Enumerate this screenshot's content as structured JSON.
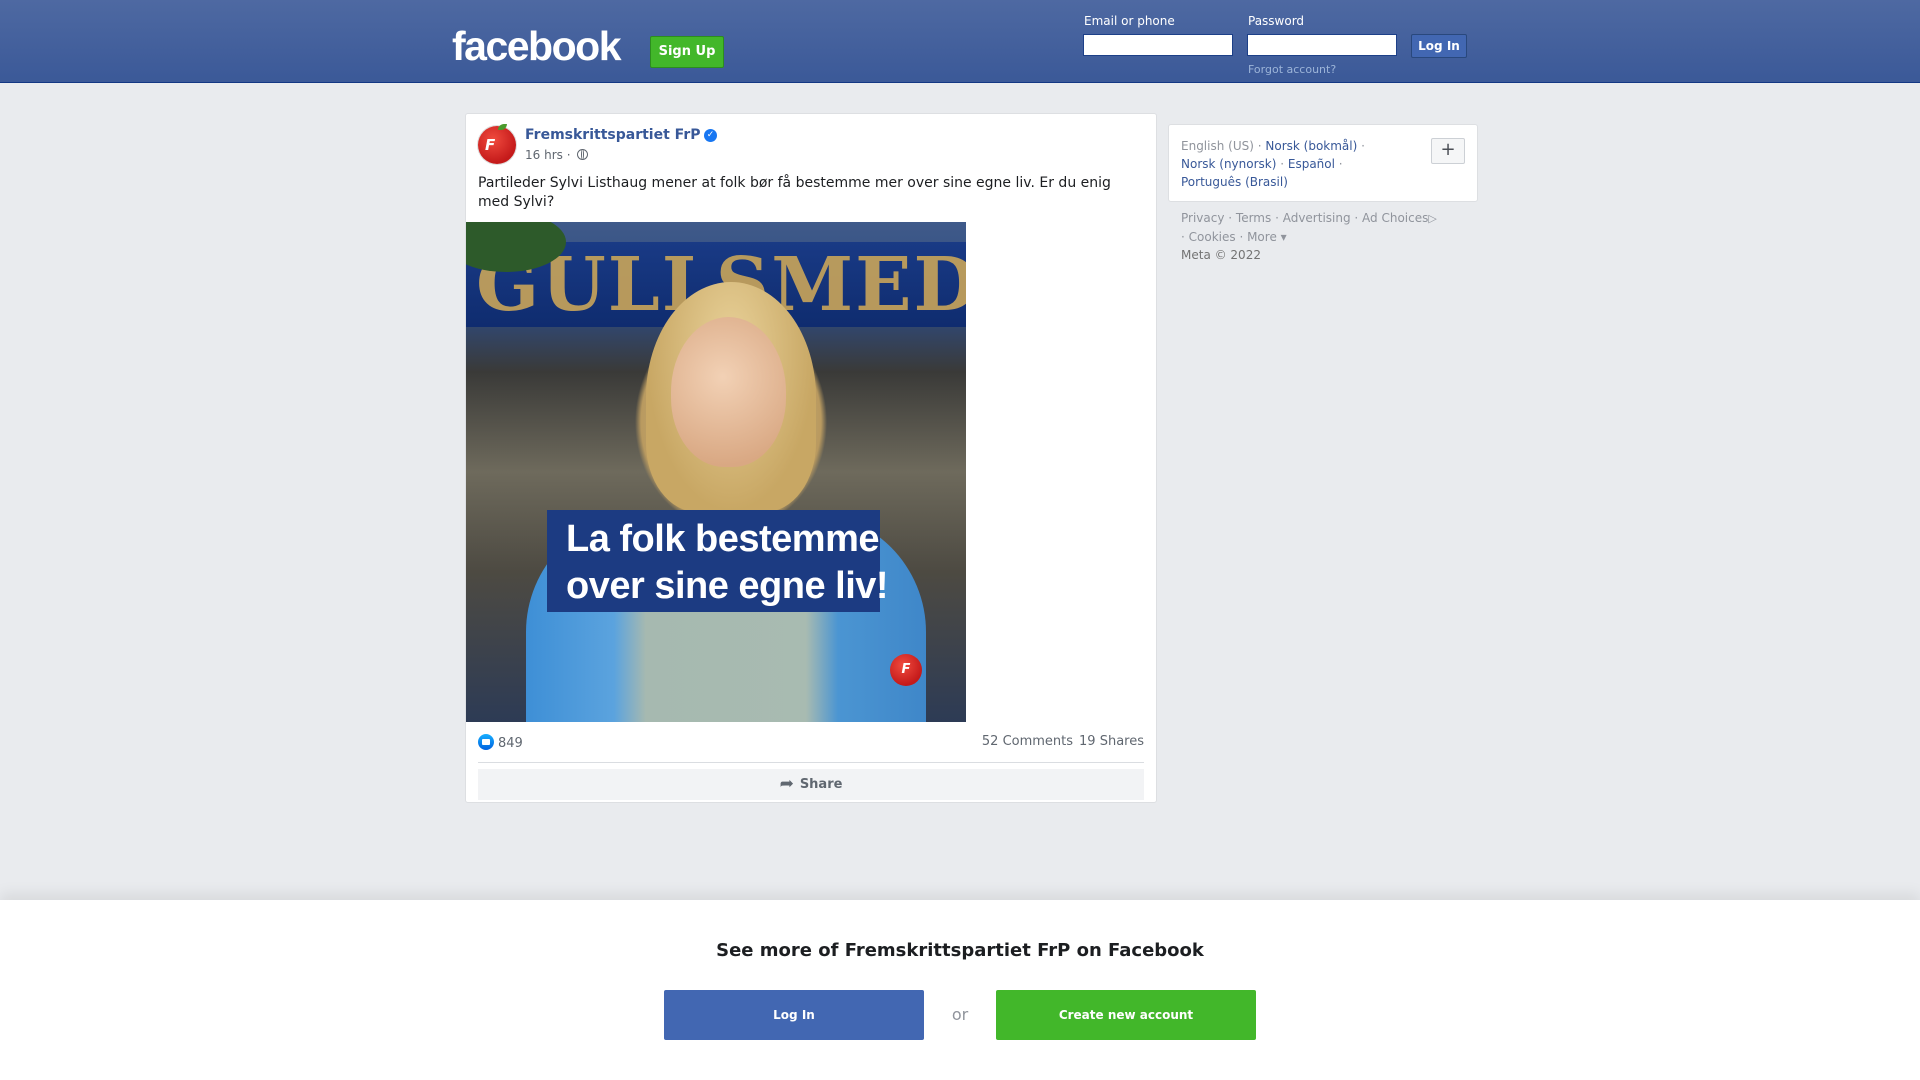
{
  "header": {
    "logo": "facebook",
    "signup_label": "Sign Up",
    "email_label": "Email or phone",
    "password_label": "Password",
    "login_label": "Log In",
    "forgot_label": "Forgot account?"
  },
  "post": {
    "page_name": "Fremskrittspartiet FrP",
    "time": "16 hrs ·",
    "text": "Partileder Sylvi Listhaug mener at folk bør få bestemme mer over sine egne liv. Er du enig med Sylvi?",
    "image": {
      "sign_text": "GULLSMED",
      "banner_line1": "La folk bestemme",
      "banner_line2": "over sine egne liv!",
      "pin_text": "F"
    },
    "avatar_text": "F",
    "reactions": "849",
    "comments": "52 Comments",
    "shares": "19 Shares",
    "share_label": "Share"
  },
  "sidebar": {
    "languages": {
      "current": "English (US)",
      "items": [
        "Norsk (bokmål)",
        "Norsk (nynorsk)",
        "Español",
        "Português (Brasil)"
      ],
      "more_label": "+"
    },
    "footer": {
      "links": [
        "Privacy",
        "Terms",
        "Advertising",
        "Ad Choices",
        "Cookies",
        "More"
      ],
      "copyright": "Meta © 2022"
    }
  },
  "bottom_banner": {
    "title": "See more of Fremskrittspartiet FrP on Facebook",
    "login_label": "Log In",
    "or_label": "or",
    "create_label": "Create new account"
  },
  "colors": {
    "brand_blue": "#3b5998",
    "button_green": "#42b72a",
    "link_blue": "#385898"
  }
}
